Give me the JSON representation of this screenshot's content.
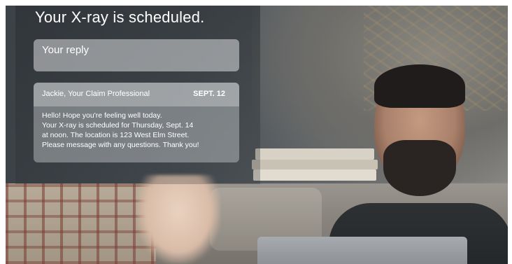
{
  "notification": {
    "title": "Your X-ray is scheduled.",
    "reply_label": "Your reply",
    "message": {
      "sender": "Jackie, Your Claim Professional",
      "date": "SEPT. 12",
      "lines": [
        "Hello! Hope you're feeling well today.",
        "Your X-ray is scheduled for Thursday, Sept. 14",
        "at noon. The location is 123 West Elm Street.",
        "Please message with any questions. Thank you!"
      ]
    }
  }
}
